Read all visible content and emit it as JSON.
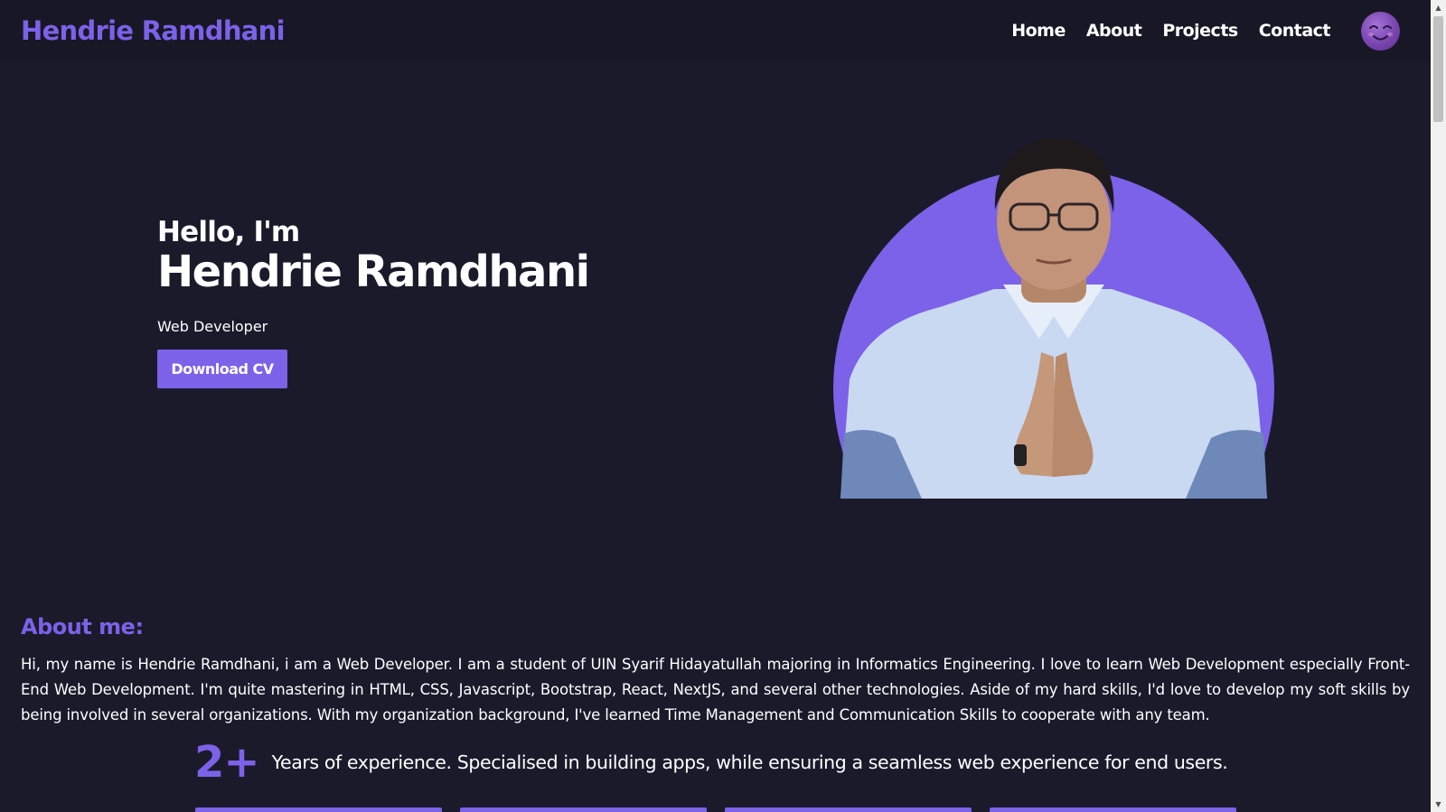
{
  "navbar": {
    "brand": "Hendrie Ramdhani",
    "links": [
      "Home",
      "About",
      "Projects",
      "Contact"
    ],
    "avatar_icon": "smiling-face-emoji-icon"
  },
  "hero": {
    "greeting": "Hello, I'm",
    "name": "Hendrie Ramdhani",
    "role": "Web Developer",
    "download_label": "Download CV"
  },
  "about": {
    "title": "About me:",
    "body": "Hi, my name is Hendrie Ramdhani, i am a Web Developer. I am a student of UIN Syarif Hidayatullah majoring in Informatics Engineering. I love to learn Web Development especially Front-End Web Development. I'm quite mastering in HTML, CSS, Javascript, Bootstrap, React, NextJS, and several other technologies. Aside of my hard skills, I'd love to develop my soft skills by being involved in several organizations. With my organization background, I've learned Time Management and Communication Skills to cooperate with any team."
  },
  "experience": {
    "number": "2+",
    "text": "Years of experience. Specialised in building apps, while ensuring a seamless web experience for end users."
  },
  "colors": {
    "accent": "#7b62e8",
    "background": "#1b1a2b",
    "navbar": "#181726"
  }
}
